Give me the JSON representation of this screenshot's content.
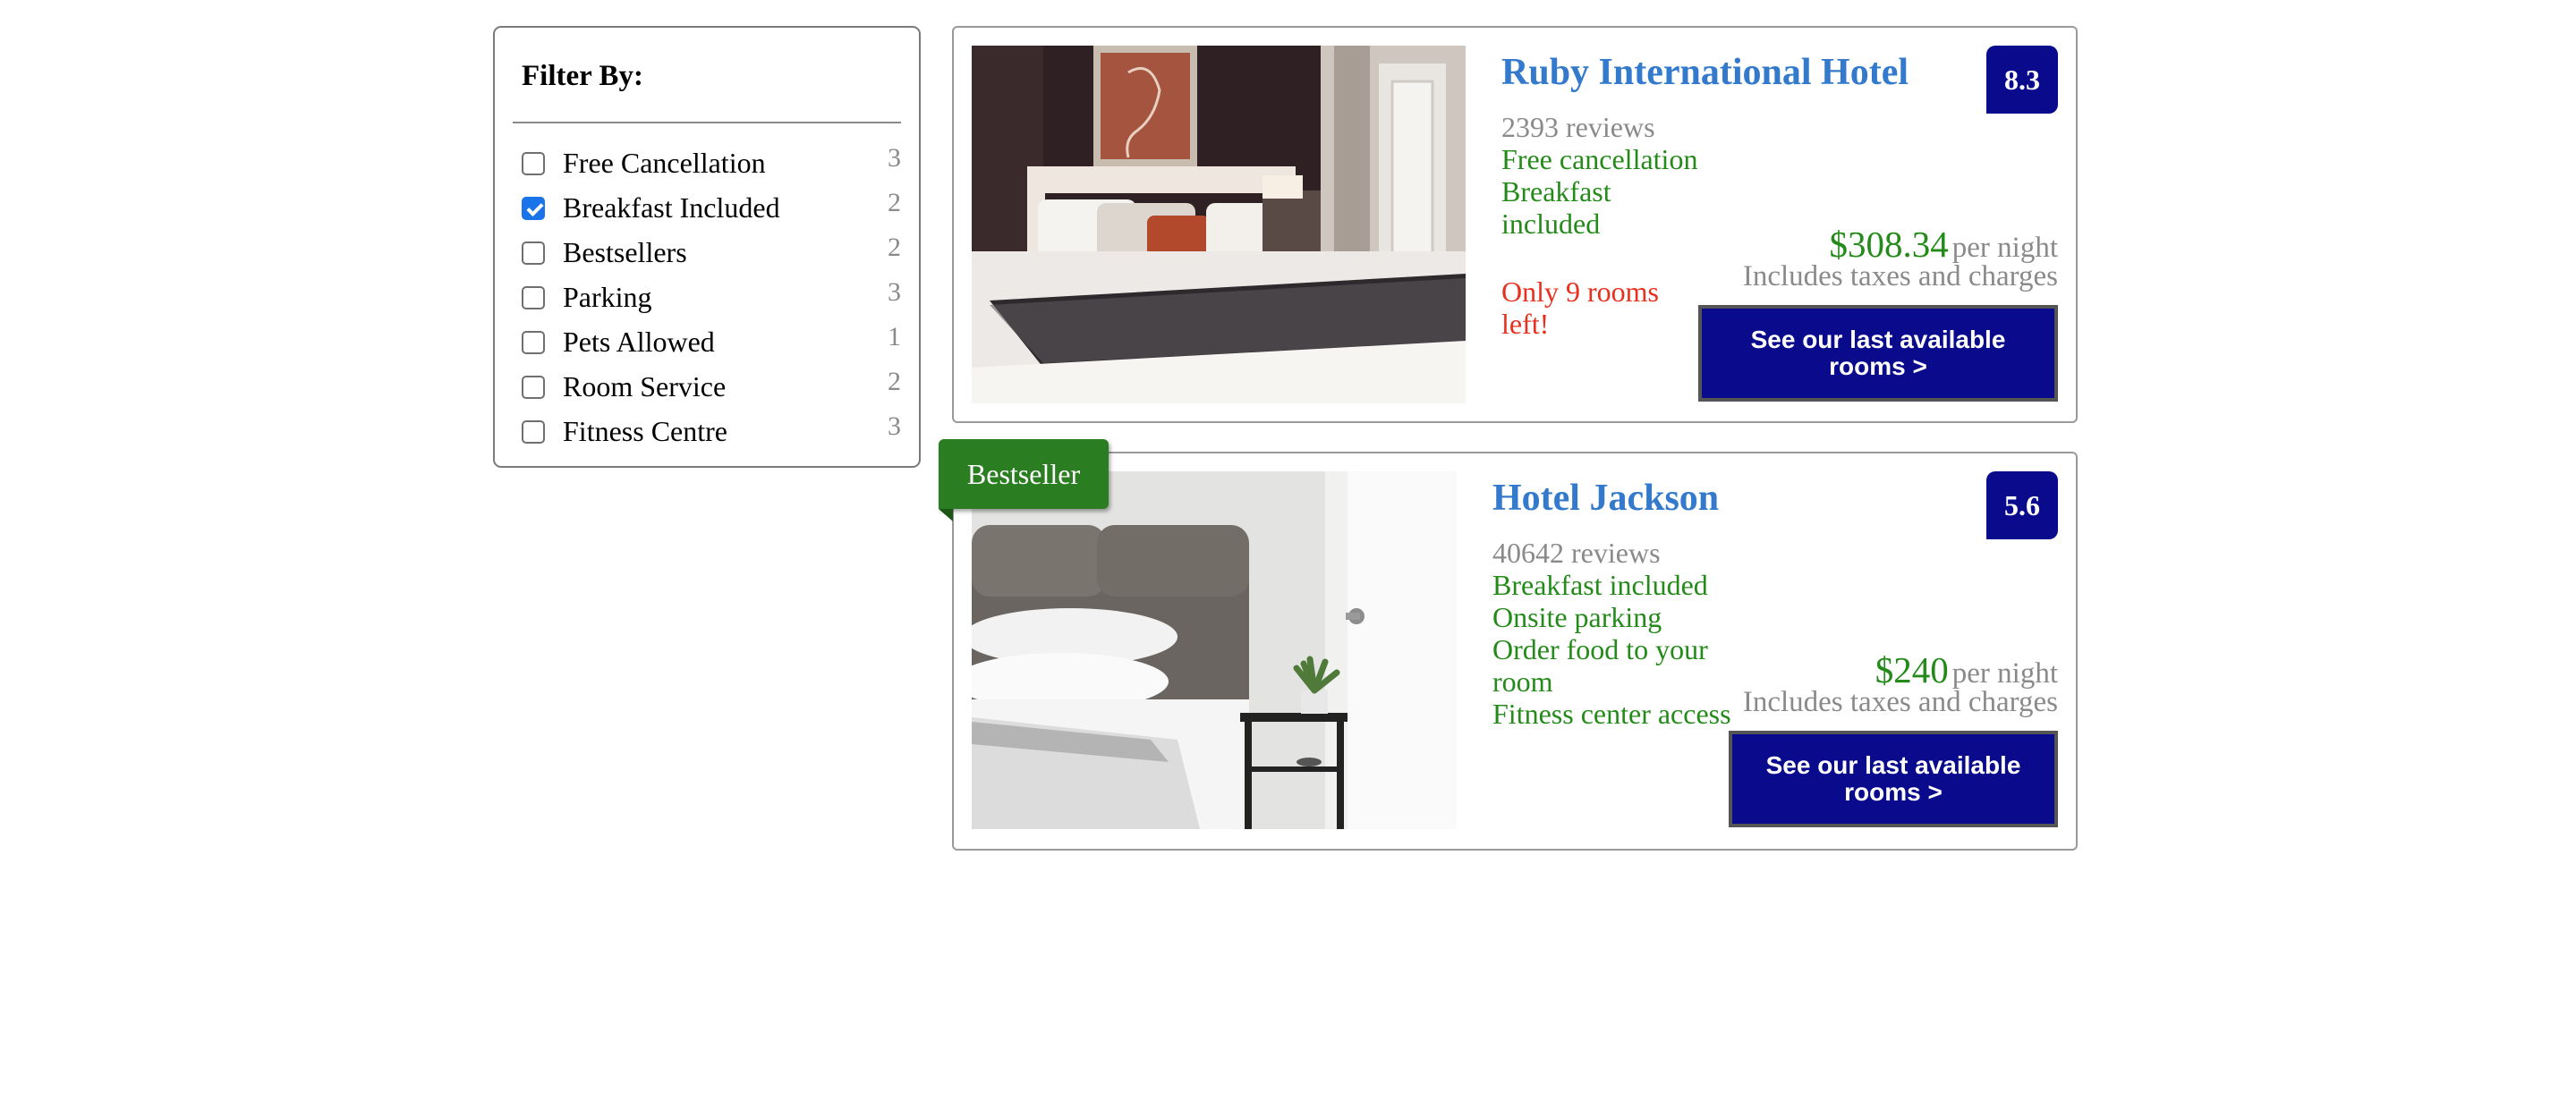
{
  "filter": {
    "title": "Filter By:",
    "options": [
      {
        "label": "Free Cancellation",
        "count": "3",
        "checked": false
      },
      {
        "label": "Breakfast Included",
        "count": "2",
        "checked": true
      },
      {
        "label": "Bestsellers",
        "count": "2",
        "checked": false
      },
      {
        "label": "Parking",
        "count": "3",
        "checked": false
      },
      {
        "label": "Pets Allowed",
        "count": "1",
        "checked": false
      },
      {
        "label": "Room Service",
        "count": "2",
        "checked": false
      },
      {
        "label": "Fitness Centre",
        "count": "3",
        "checked": false
      }
    ]
  },
  "hotels": [
    {
      "name": "Ruby International Hotel",
      "score": "8.3",
      "reviews": "2393 reviews",
      "features": [
        "Free cancellation",
        "Breakfast included"
      ],
      "urgency": "Only 9 rooms left!",
      "price": "$308.34",
      "per_night": "per night",
      "taxes": "Includes taxes and charges",
      "cta": "See our last available rooms >"
    },
    {
      "name": "Hotel Jackson",
      "score": "5.6",
      "badge": "Bestseller",
      "reviews": "40642 reviews",
      "features": [
        "Breakfast included",
        "Onsite parking",
        "Order food to your room",
        "Fitness center access"
      ],
      "price": "$240",
      "per_night": "per night",
      "taxes": "Includes taxes and charges",
      "cta": "See our last available rooms >"
    }
  ],
  "colors": {
    "link_blue": "#3379cc",
    "navy": "#0a0a8c",
    "green": "#248a1a",
    "red": "#e8301e",
    "grey": "#8a8a8a",
    "ribbon_green": "#2b7d22"
  }
}
